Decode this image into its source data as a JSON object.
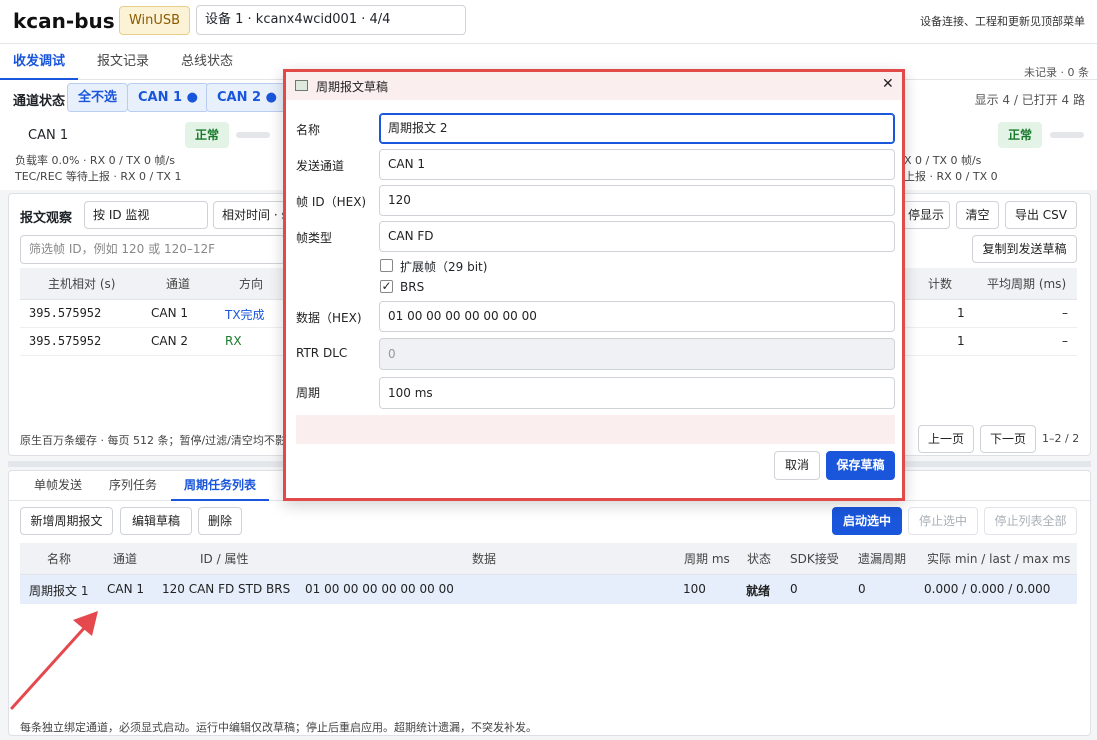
{
  "header": {
    "app_title": "kcan-bus",
    "badge": "WinUSB",
    "device": "设备 1 · kcanx4wcid001 · 4/4",
    "hint": "设备连接、工程和更新见顶部菜单"
  },
  "main_tabs": [
    {
      "label": "收发调试"
    },
    {
      "label": "报文记录"
    },
    {
      "label": "总线状态"
    }
  ],
  "record_count": "未记录 · 0 条",
  "channel_status": {
    "title": "通道状态",
    "deselect_all": "全不选",
    "channels": [
      {
        "label": "CAN 1 ●"
      },
      {
        "label": "CAN 2 ●"
      }
    ],
    "summary": "显示 4 / 已打开 4 路",
    "card_left": {
      "name": "CAN 1",
      "state": "正常",
      "line1": "负载率 0.0% · RX 0 / TX 0 帧/s",
      "line2": "TEC/REC 等待上报 · RX 0 / TX 1"
    },
    "card_right": {
      "state": "正常",
      "line1": "X 0 / TX 0 帧/s",
      "line2": "上报 · RX 0 / TX 0"
    }
  },
  "observe": {
    "title": "报文观察",
    "mode": "按 ID 监视",
    "time": "相对时间 · s",
    "filter_placeholder": "筛选帧 ID，例如 120 或 120–12F",
    "pause_display": "停显示",
    "clear": "清空",
    "export": "导出 CSV",
    "copy_draft": "复制到发送草稿",
    "columns": [
      "主机相对 (s)",
      "通道",
      "方向",
      "计数",
      "平均周期 (ms)"
    ],
    "rows": [
      {
        "time": "395.575952",
        "channel": "CAN 1",
        "dir": "TX完成",
        "count": "1",
        "period": "–"
      },
      {
        "time": "395.575952",
        "channel": "CAN 2",
        "dir": "RX",
        "count": "1",
        "period": "–"
      }
    ],
    "footer": "原生百万条缓存 · 每页 512 条；暂停/过滤/清空均不影",
    "prev": "上一页",
    "next": "下一页",
    "page": "1–2 / 2"
  },
  "send_tabs": [
    {
      "label": "单帧发送"
    },
    {
      "label": "序列任务"
    },
    {
      "label": "周期任务列表"
    }
  ],
  "periodic": {
    "new": "新增周期报文",
    "edit": "编辑草稿",
    "delete": "删除",
    "start_selected": "启动选中",
    "stop_selected": "停止选中",
    "stop_all": "停止列表全部",
    "columns": [
      "名称",
      "通道",
      "ID / 属性",
      "数据",
      "周期 ms",
      "状态",
      "SDK接受",
      "遗漏周期",
      "实际 min / last / max ms"
    ],
    "rows": [
      {
        "name": "周期报文 1",
        "channel": "CAN 1",
        "id": "120 CAN FD STD BRS",
        "data": "01 00 00 00 00 00 00 00",
        "period": "100",
        "state": "就绪",
        "sdk": "0",
        "missed": "0",
        "actual": "0.000 / 0.000 / 0.000"
      }
    ],
    "footer": "每条独立绑定通道，必须显式启动。运行中编辑仅改草稿；停止后重启应用。超期统计遗漏，不突发补发。"
  },
  "modal": {
    "title": "周期报文草稿",
    "close": "✕",
    "name_label": "名称",
    "name_value": "周期报文 2",
    "channel_label": "发送通道",
    "channel_value": "CAN 1",
    "id_label": "帧 ID（HEX)",
    "id_value": "120",
    "type_label": "帧类型",
    "type_value": "CAN FD",
    "extended_label": "扩展帧（29 bit)",
    "brs_label": "BRS",
    "data_label": "数据（HEX)",
    "data_value": "01 00 00 00 00 00 00 00",
    "rtr_label": "RTR DLC",
    "rtr_value": "0",
    "period_label": "周期",
    "period_value": "100 ms",
    "cancel": "取消",
    "save": "保存草稿"
  },
  "colors": {
    "accent": "#1a56db",
    "highlight": "#e24a4a",
    "ok": "#197a2c"
  }
}
